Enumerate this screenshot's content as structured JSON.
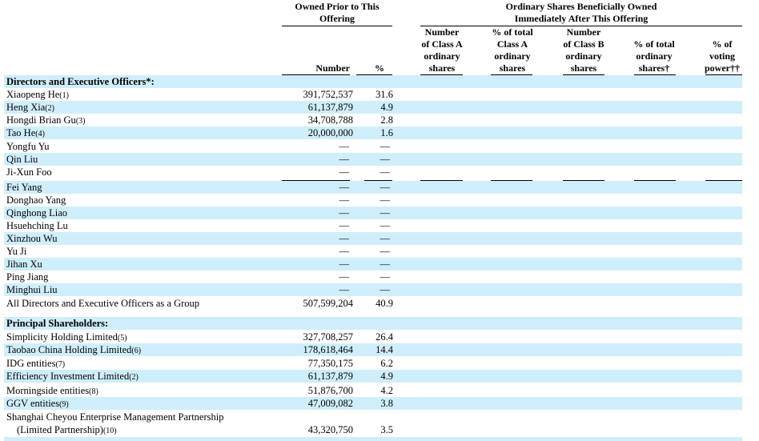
{
  "header": {
    "owned_prior": "Owned Prior to This Offering",
    "owned_after_line1": "Ordinary Shares Beneficially Owned",
    "owned_after_line2": "Immediately After This Offering",
    "col_number": "Number",
    "col_pct": "%",
    "col_class_a": [
      "Number",
      "of Class A",
      "ordinary",
      "shares"
    ],
    "col_pct_class_a": [
      "% of total",
      "Class A",
      "ordinary",
      "shares"
    ],
    "col_class_b": [
      "Number",
      "of Class B",
      "ordinary",
      "shares"
    ],
    "col_pct_total": [
      "% of total",
      "ordinary",
      "shares†"
    ],
    "col_voting": [
      "% of",
      "voting",
      "power††"
    ]
  },
  "sections": {
    "directors": "Directors and Executive Officers*:",
    "principal": "Principal Shareholders:"
  },
  "rows": [
    {
      "name": "Xiaopeng He",
      "fn": "(1)",
      "number": "391,752,537",
      "pct": "31.6"
    },
    {
      "name": "Heng Xia",
      "fn": "(2)",
      "number": "61,137,879",
      "pct": "4.9"
    },
    {
      "name": "Hongdi Brian Gu",
      "fn": "(3)",
      "number": "34,708,788",
      "pct": "2.8"
    },
    {
      "name": "Tao He",
      "fn": "(4)",
      "number": "20,000,000",
      "pct": "1.6"
    },
    {
      "name": "Yongfu Yu",
      "fn": "",
      "number": "—",
      "pct": "—"
    },
    {
      "name": "Qin Liu",
      "fn": "",
      "number": "—",
      "pct": "—"
    },
    {
      "name": "Ji-Xun Foo",
      "fn": "",
      "number": "—",
      "pct": "—"
    },
    {
      "name": "Fei Yang",
      "fn": "",
      "number": "—",
      "pct": "—"
    },
    {
      "name": "Donghao Yang",
      "fn": "",
      "number": "—",
      "pct": "—"
    },
    {
      "name": "Qinghong Liao",
      "fn": "",
      "number": "—",
      "pct": "—"
    },
    {
      "name": "Hsuehching Lu",
      "fn": "",
      "number": "—",
      "pct": "—"
    },
    {
      "name": "Xinzhou Wu",
      "fn": "",
      "number": "—",
      "pct": "—"
    },
    {
      "name": "Yu Ji",
      "fn": "",
      "number": "—",
      "pct": "—"
    },
    {
      "name": "Jihan Xu",
      "fn": "",
      "number": "—",
      "pct": "—"
    },
    {
      "name": "Ping Jiang",
      "fn": "",
      "number": "—",
      "pct": "—"
    },
    {
      "name": "Minghui Liu",
      "fn": "",
      "number": "—",
      "pct": "—"
    },
    {
      "name": "All Directors and Executive Officers as a Group",
      "fn": "",
      "number": "507,599,204",
      "pct": "40.9"
    }
  ],
  "principal_rows": [
    {
      "name": "Simplicity Holding Limited",
      "fn": "(5)",
      "number": "327,708,257",
      "pct": "26.4"
    },
    {
      "name": "Taobao China Holding Limited",
      "fn": "(6)",
      "number": "178,618,464",
      "pct": "14.4"
    },
    {
      "name": "IDG entities",
      "fn": "(7)",
      "number": "77,350,175",
      "pct": "6.2"
    },
    {
      "name": "Efficiency Investment Limited",
      "fn": "(2)",
      "number": "61,137,879",
      "pct": "4.9"
    },
    {
      "name": "Morningside entities",
      "fn": "(8)",
      "number": "51,876,700",
      "pct": "4.2"
    },
    {
      "name": "GGV entities",
      "fn": "(9)",
      "number": "47,009,082",
      "pct": "3.8"
    },
    {
      "name": "Shanghai Cheyou Enterprise Management Partnership",
      "name2": "(Limited Partnership)",
      "fn": "(10)",
      "number": "43,320,750",
      "pct": "3.5"
    }
  ]
}
